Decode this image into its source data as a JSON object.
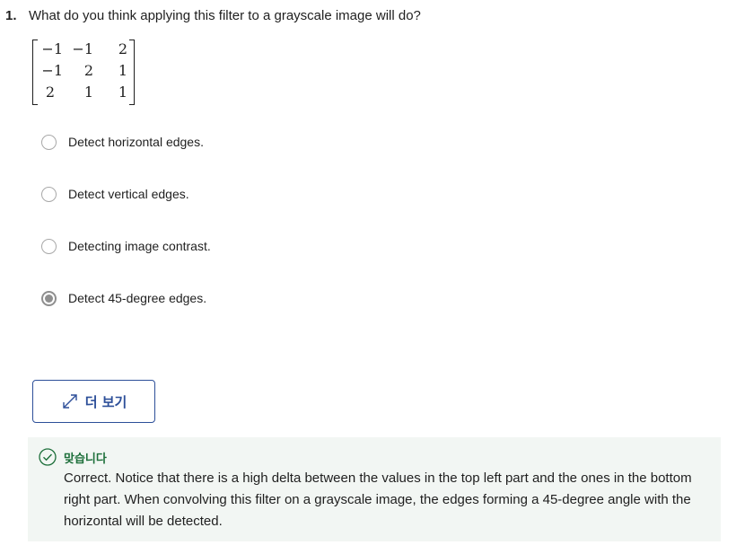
{
  "question": {
    "number": "1.",
    "text": "What do you think applying this filter to a grayscale image will do?"
  },
  "matrix": {
    "rows": [
      [
        "−1",
        "−1",
        "2"
      ],
      [
        "−1",
        "2",
        "1"
      ],
      [
        "2",
        "1",
        "1"
      ]
    ]
  },
  "options": [
    {
      "label": "Detect horizontal edges.",
      "selected": false
    },
    {
      "label": "Detect vertical edges.",
      "selected": false
    },
    {
      "label": "Detecting image contrast.",
      "selected": false
    },
    {
      "label": "Detect 45-degree edges.",
      "selected": true
    }
  ],
  "more_button": {
    "label": "더 보기",
    "icon": "expand-icon"
  },
  "feedback": {
    "status": "맞습니다",
    "icon": "check-circle-icon",
    "text": "Correct. Notice that there is a high delta between the values in the top left part and the ones in the bottom right part. When convolving this filter on a grayscale image, the edges forming a 45-degree angle with the horizontal will be detected."
  },
  "colors": {
    "accent": "#2d4f99",
    "success": "#1d6f3a",
    "feedback_bg": "#f2f6f3"
  }
}
